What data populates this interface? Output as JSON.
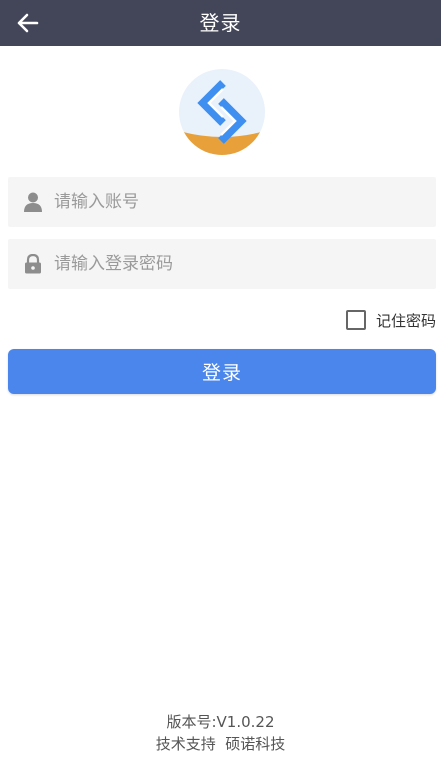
{
  "header": {
    "title": "登录",
    "back_icon": "arrow-left-icon"
  },
  "logo": {
    "icon": "app-logo-s-icon",
    "colors": {
      "blue": "#3f8ff0",
      "orange": "#e8a13a",
      "bg": "#e9f1fb"
    }
  },
  "form": {
    "account_placeholder": "请输入账号",
    "account_icon": "user-icon",
    "password_placeholder": "请输入登录密码",
    "password_icon": "lock-icon",
    "remember_label": "记住密码",
    "remember_checked": false,
    "submit_label": "登录"
  },
  "footer": {
    "version": "版本号:V1.0.22",
    "support": "技术支持  硕诺科技"
  },
  "colors": {
    "topbar": "#424658",
    "primary": "#4a86ec",
    "field_bg": "#f5f5f5"
  }
}
